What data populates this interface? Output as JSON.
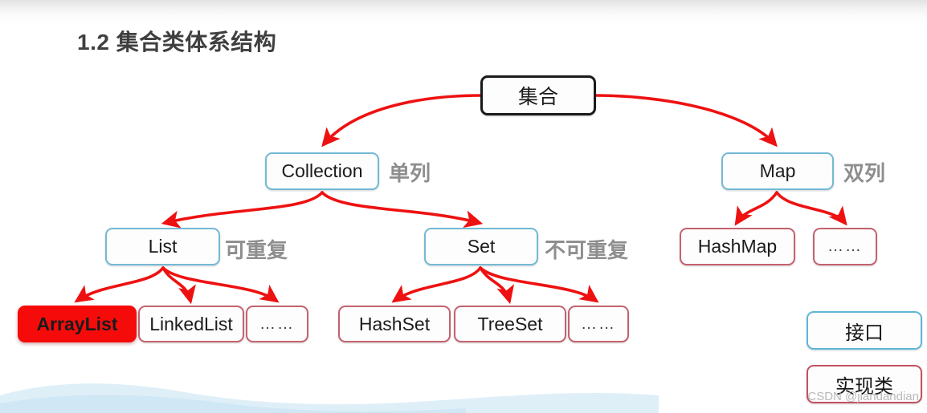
{
  "page": {
    "title": "1.2 集合类体系结构",
    "watermark": "CSDN @jiandandian"
  },
  "colors": {
    "arrow": "#ee1111",
    "interface_border": "#73b9d4",
    "impl_border": "#c4626e",
    "root_border": "#1a1a1a",
    "highlight_bg": "#f60b0b",
    "side_label": "#8e8e8e",
    "title": "#3f3f3f"
  },
  "diagram": {
    "nodes": {
      "root": {
        "label": "集合",
        "kind": "root"
      },
      "collection": {
        "label": "Collection",
        "kind": "interface"
      },
      "map": {
        "label": "Map",
        "kind": "interface"
      },
      "list": {
        "label": "List",
        "kind": "interface"
      },
      "set": {
        "label": "Set",
        "kind": "interface"
      },
      "hashmap": {
        "label": "HashMap",
        "kind": "implementation"
      },
      "map_more": {
        "label": "……",
        "kind": "implementation"
      },
      "arraylist": {
        "label": "ArrayList",
        "kind": "implementation-highlighted"
      },
      "linkedlist": {
        "label": "LinkedList",
        "kind": "implementation"
      },
      "list_more": {
        "label": "……",
        "kind": "implementation"
      },
      "hashset": {
        "label": "HashSet",
        "kind": "implementation"
      },
      "treeset": {
        "label": "TreeSet",
        "kind": "implementation"
      },
      "set_more": {
        "label": "……",
        "kind": "implementation"
      }
    },
    "annotations": {
      "collection_note": "单列",
      "map_note": "双列",
      "list_note": "可重复",
      "set_note": "不可重复"
    },
    "edges": [
      {
        "from": "root",
        "to": "collection"
      },
      {
        "from": "root",
        "to": "map"
      },
      {
        "from": "collection",
        "to": "list"
      },
      {
        "from": "collection",
        "to": "set"
      },
      {
        "from": "map",
        "to": "hashmap"
      },
      {
        "from": "map",
        "to": "map_more"
      },
      {
        "from": "list",
        "to": "arraylist"
      },
      {
        "from": "list",
        "to": "linkedlist"
      },
      {
        "from": "list",
        "to": "list_more"
      },
      {
        "from": "set",
        "to": "hashset"
      },
      {
        "from": "set",
        "to": "treeset"
      },
      {
        "from": "set",
        "to": "set_more"
      }
    ]
  },
  "legend": {
    "interface": "接口",
    "implementation": "实现类"
  }
}
